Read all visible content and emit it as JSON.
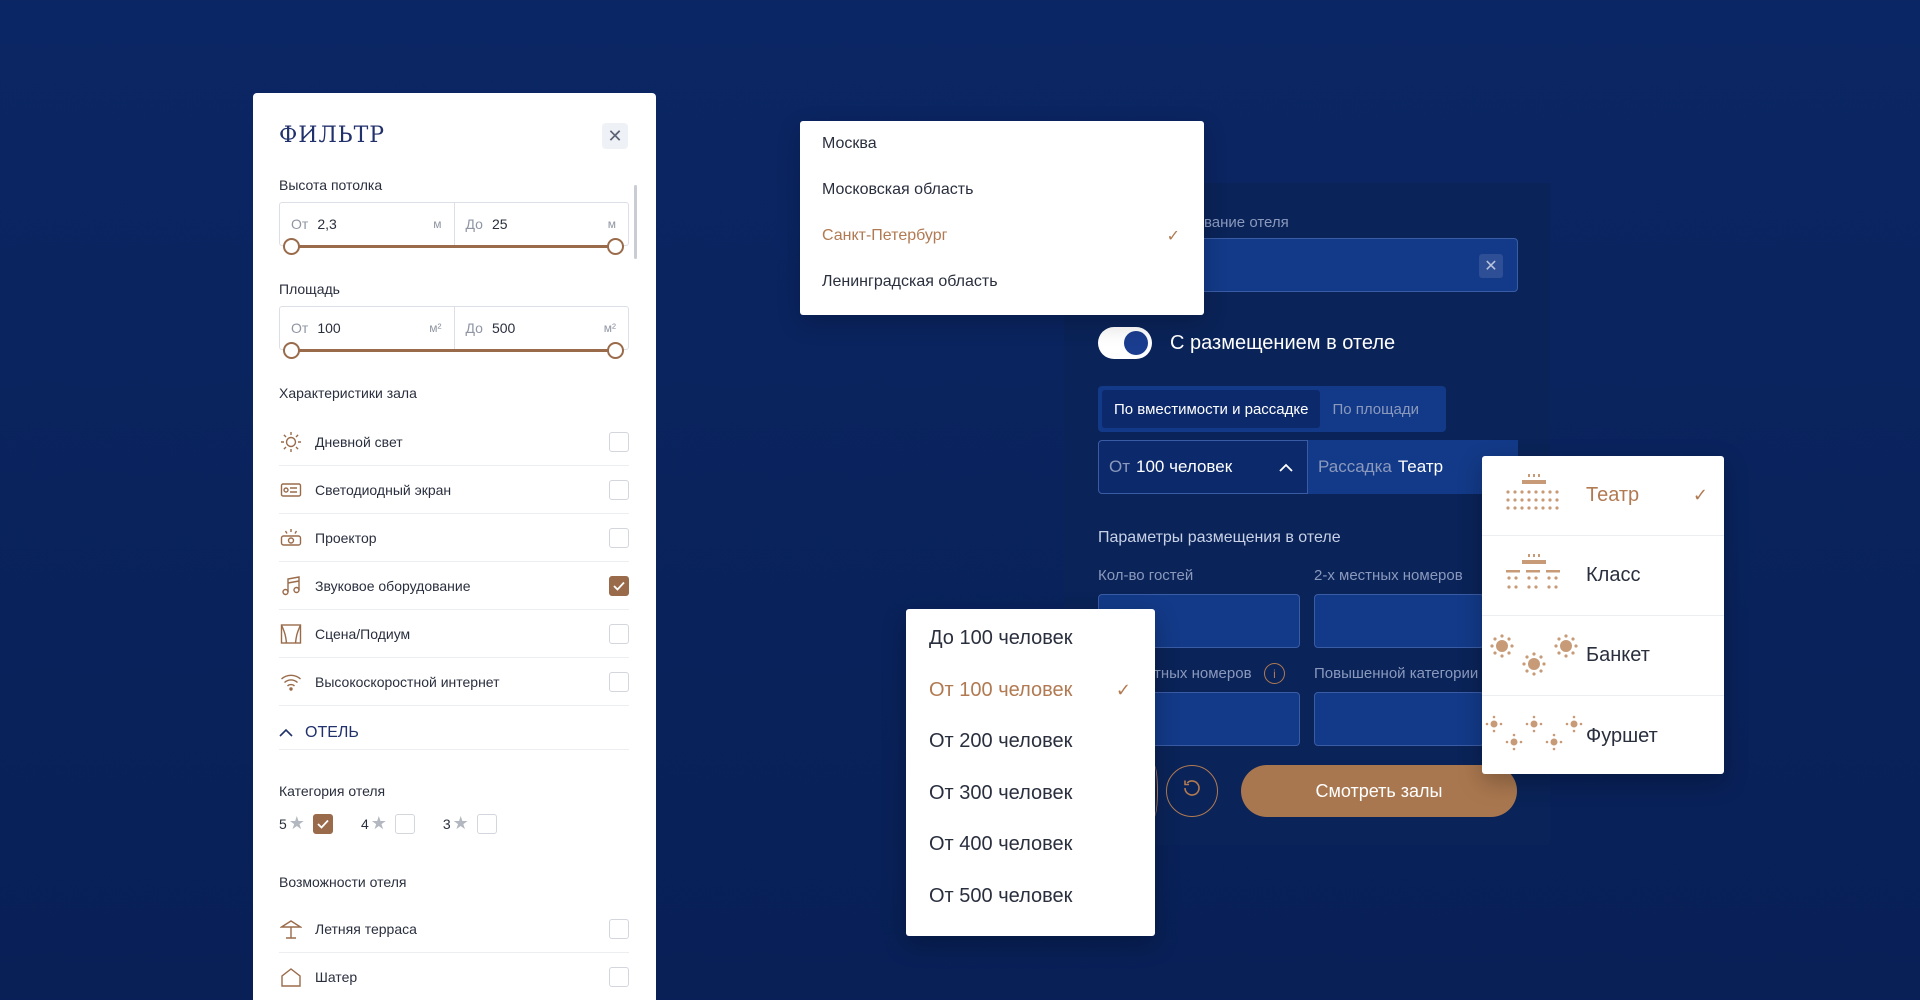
{
  "filter": {
    "title": "ФИЛЬТР",
    "close_glyph": "✕",
    "ceiling": {
      "label": "Высота потолка",
      "from_prefix": "От",
      "from_value": "2,3",
      "to_prefix": "До",
      "to_value": "25",
      "unit": "м"
    },
    "area": {
      "label": "Площадь",
      "from_prefix": "От",
      "from_value": "100",
      "to_prefix": "До",
      "to_value": "500",
      "unit": "м²"
    },
    "hall_features_label": "Характеристики зала",
    "hall_features": [
      {
        "label": "Дневной свет",
        "icon": "sun-icon",
        "checked": false
      },
      {
        "label": "Светодиодный экран",
        "icon": "led-screen-icon",
        "checked": false
      },
      {
        "label": "Проектор",
        "icon": "projector-icon",
        "checked": false
      },
      {
        "label": "Звуковое оборудование",
        "icon": "music-icon",
        "checked": true
      },
      {
        "label": "Сцена/Подиум",
        "icon": "stage-icon",
        "checked": false
      },
      {
        "label": "Высокоскоростной интернет",
        "icon": "wifi-icon",
        "checked": false
      }
    ],
    "hotel_section": "ОТЕЛЬ",
    "hotel_category_label": "Категория отеля",
    "stars": [
      {
        "value": "5",
        "checked": true
      },
      {
        "value": "4",
        "checked": false
      },
      {
        "value": "3",
        "checked": false
      }
    ],
    "hotel_features_label": "Возможности отеля",
    "hotel_features": [
      {
        "label": "Летняя терраса",
        "icon": "umbrella-icon",
        "checked": false
      },
      {
        "label": "Шатер",
        "icon": "tent-icon",
        "checked": false
      }
    ]
  },
  "city_dropdown": {
    "items": [
      "Москва",
      "Московская область",
      "Санкт-Петербург",
      "Ленинградская область"
    ],
    "selected_index": 2
  },
  "search_form": {
    "hotel_name_label": "вание отеля",
    "with_hotel_label": "С размещением в отеле",
    "tabs": [
      "По вместимости и рассадке",
      "По площади"
    ],
    "capacity_prefix": "От",
    "capacity_value": "100 человек",
    "seating_prefix": "Рассадка",
    "seating_value": "Театр",
    "accommodation_title": "Параметры размещения в отеле",
    "guests_label": "Кол-во гостей",
    "double_rooms_label": "2-х местных номеров",
    "rooms_label": "тных номеров",
    "superior_label": "Повышенной категории",
    "submit_label": "Смотреть залы"
  },
  "capacity_dropdown": {
    "items": [
      "До 100 человек",
      "От 100 человек",
      "От 200 человек",
      "От 300 человек",
      "От 400 человек",
      "От 500 человек"
    ],
    "selected_index": 1
  },
  "seating_dropdown": {
    "items": [
      "Театр",
      "Класс",
      "Банкет",
      "Фуршет"
    ],
    "selected_index": 0
  },
  "colors": {
    "accent": "#B17A52",
    "navy": "#0B2664",
    "panel": "#0A2358"
  }
}
